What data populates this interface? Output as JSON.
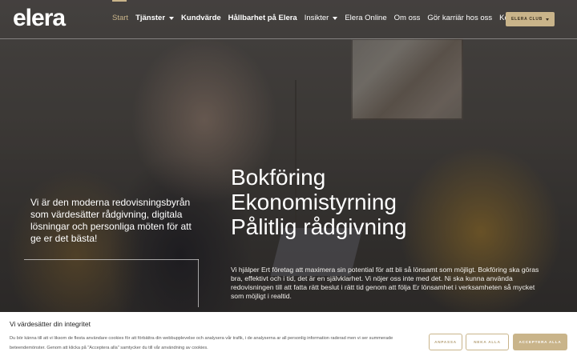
{
  "header": {
    "logo": "elera",
    "nav": [
      {
        "label": "Start",
        "active": true,
        "bold": false,
        "dropdown": false
      },
      {
        "label": "Tjänster",
        "active": false,
        "bold": true,
        "dropdown": true
      },
      {
        "label": "Kundvärde",
        "active": false,
        "bold": true,
        "dropdown": false
      },
      {
        "label": "Hållbarhet på Elera",
        "active": false,
        "bold": true,
        "dropdown": false
      },
      {
        "label": "Insikter",
        "active": false,
        "bold": false,
        "dropdown": true
      },
      {
        "label": "Elera Online",
        "active": false,
        "bold": false,
        "dropdown": false
      },
      {
        "label": "Om oss",
        "active": false,
        "bold": false,
        "dropdown": false
      },
      {
        "label": "Gör karriär hos oss",
        "active": false,
        "bold": false,
        "dropdown": false
      },
      {
        "label": "Kontakt",
        "active": false,
        "bold": false,
        "dropdown": false
      }
    ],
    "club_button": "ELERA CLUB"
  },
  "hero": {
    "left_text": "Vi är den moderna redovisningsbyrån som värdesätter rådgivning, digitala lösningar och personliga möten för att ge er det bästa!",
    "headline": [
      "Bokföring",
      "Ekonomistyrning",
      "Pålitlig rådgivning"
    ],
    "body": "Vi hjälper Ert företag att maximera sin potential för att bli så lönsamt som möjligt. Bokföring ska göras bra, effektivt och i tid, det är en självklarhet. Vi nöjer oss inte med det. Ni ska kunna använda redovisningen till att fatta rätt beslut i rätt tid genom att följa Er lönsamhet i verksamheten så mycket som möjligt i realtid."
  },
  "cookie": {
    "title": "Vi värdesätter din integritet",
    "text": "Du bör känna till att vi liksom de flesta användare cookies för att förbättra din webbupplevelse och analysera vår trafik, i de analyserna ar all personlig information raderad men vi ser summerade beteendemönster. Genom att klicka på \"Acceptera alla\" samtycker du till vår användning av cookies.",
    "buttons": {
      "customize": "ANPASSA",
      "reject": "NEKA ALLA",
      "accept": "ACCEPTERA ALLA"
    }
  },
  "colors": {
    "accent": "#c9b48a",
    "active_nav": "#c9b48a"
  }
}
